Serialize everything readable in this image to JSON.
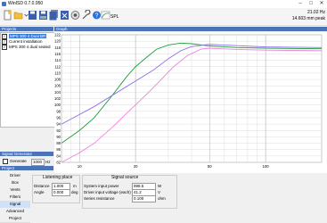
{
  "window": {
    "title": "WinISD 0.7.0.950"
  },
  "status": {
    "line1": "21.02 Hz",
    "line2": "14.603 mm peak"
  },
  "toolbar": {
    "spl_label": "SPL"
  },
  "panels": {
    "projects": "Projects",
    "graph": "Graph",
    "signal_generator": "Signal Generator",
    "project": "Project"
  },
  "projects": [
    {
      "label": "MPS 300 4 Dual BR",
      "checked": true,
      "selected": true
    },
    {
      "label": "Current installation",
      "checked": true,
      "selected": false
    },
    {
      "label": "MPS 300 4 dual sealed",
      "checked": true,
      "selected": false
    }
  ],
  "signal_generator": {
    "generate_label": "Generate",
    "freq_value": "1000",
    "freq_unit": "Hz"
  },
  "nav": [
    "Driver",
    "Box",
    "Vents",
    "Filters",
    "Signal",
    "Advanced",
    "Project"
  ],
  "nav_selected": "Signal",
  "listening_place": {
    "title": "Listening place",
    "distance_label": "Distance",
    "distance_value": "1.000",
    "distance_unit": "m",
    "angle_label": "Angle",
    "angle_value": "0.000",
    "angle_unit": "deg"
  },
  "signal_source": {
    "title": "Signal source",
    "power_label": "System input power",
    "power_value": "998.5",
    "power_unit": "W",
    "voltage_label": "Driver input voltage (each)",
    "voltage_value": "41.2",
    "voltage_unit": "V",
    "resistance_label": "Series resistance",
    "resistance_value": "0.100",
    "resistance_unit": "ohm"
  },
  "chart_data": {
    "type": "line",
    "xscale": "log",
    "xlim": [
      8,
      200
    ],
    "ylim": [
      82,
      122
    ],
    "x_ticks": [
      "10",
      "20",
      "50",
      "100"
    ],
    "y_ticks": [
      "122",
      "120",
      "118",
      "116",
      "114",
      "112",
      "110",
      "108",
      "106",
      "104",
      "102",
      "100",
      "98",
      "96",
      "94",
      "92",
      "90",
      "88",
      "86",
      "84",
      "82"
    ],
    "series": [
      {
        "color": "#1e9e3a",
        "points": [
          [
            8,
            88
          ],
          [
            10,
            92
          ],
          [
            12,
            96
          ],
          [
            15,
            103
          ],
          [
            18,
            109
          ],
          [
            20,
            112
          ],
          [
            23,
            115
          ],
          [
            26,
            117.5
          ],
          [
            30,
            118.8
          ],
          [
            35,
            119.4
          ],
          [
            40,
            119.2
          ],
          [
            50,
            118.5
          ],
          [
            70,
            118
          ],
          [
            100,
            117.8
          ],
          [
            200,
            117.6
          ]
        ]
      },
      {
        "color": "#8a6fe8",
        "points": [
          [
            8,
            94
          ],
          [
            10,
            97
          ],
          [
            12,
            99.5
          ],
          [
            15,
            103
          ],
          [
            20,
            107.5
          ],
          [
            25,
            111
          ],
          [
            30,
            114.5
          ],
          [
            35,
            117
          ],
          [
            40,
            118.3
          ],
          [
            50,
            119
          ],
          [
            70,
            118.6
          ],
          [
            100,
            118.2
          ],
          [
            200,
            118
          ]
        ]
      },
      {
        "color": "#f080e0",
        "points": [
          [
            8,
            82
          ],
          [
            10,
            85
          ],
          [
            12,
            88
          ],
          [
            15,
            93
          ],
          [
            18,
            97.5
          ],
          [
            20,
            100
          ],
          [
            24,
            104.5
          ],
          [
            28,
            108.5
          ],
          [
            32,
            112
          ],
          [
            38,
            115.5
          ],
          [
            45,
            117.5
          ],
          [
            50,
            117.8
          ],
          [
            70,
            117.4
          ],
          [
            100,
            117.2
          ],
          [
            200,
            117
          ]
        ]
      }
    ]
  }
}
